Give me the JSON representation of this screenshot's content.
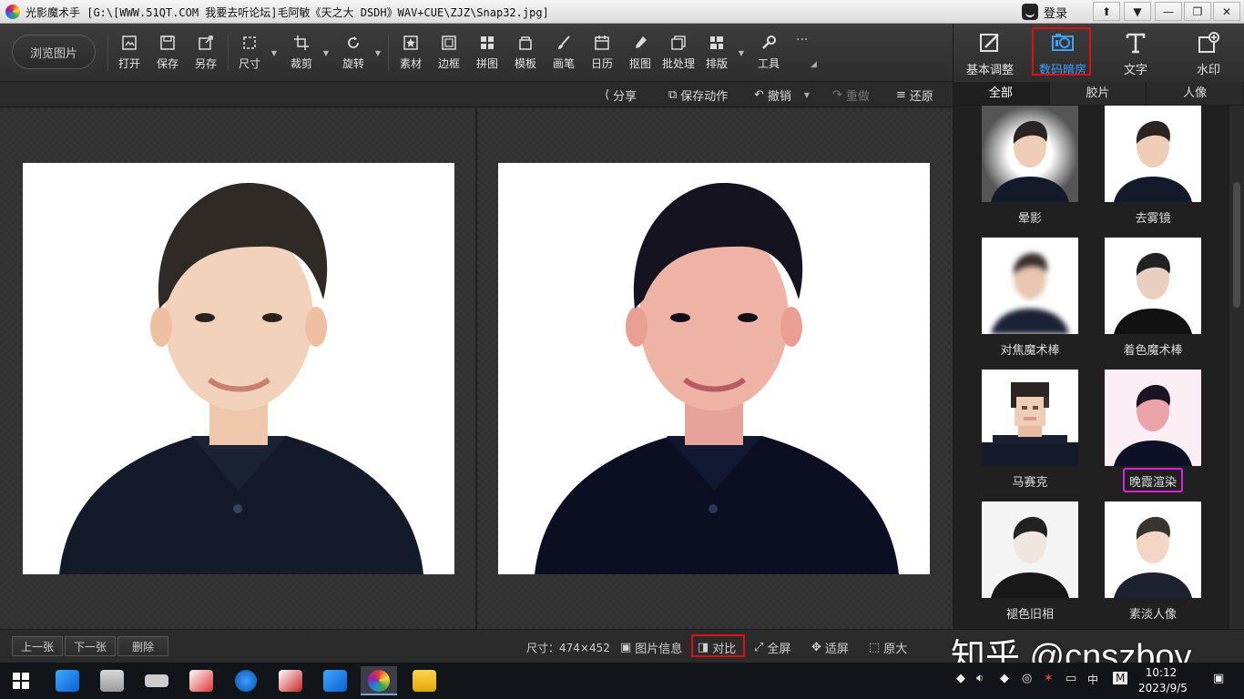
{
  "window": {
    "title": "光影魔术手 [G:\\[WWW.51QT.COM 我要去听论坛]毛阿敏《天之大 DSDH》WAV+CUE\\ZJZ\\Snap32.jpg]",
    "login_label": "登录",
    "controls": [
      "⬆",
      "▼",
      "—",
      "❐",
      "✕"
    ]
  },
  "toolbar": {
    "browse_label": "浏览图片",
    "tools": [
      {
        "label": "打开",
        "icon": "open-icon"
      },
      {
        "label": "保存",
        "icon": "save-icon"
      },
      {
        "label": "另存",
        "icon": "save-as-icon"
      },
      {
        "label": "尺寸",
        "icon": "resize-icon"
      },
      {
        "label": "裁剪",
        "icon": "crop-icon"
      },
      {
        "label": "旋转",
        "icon": "rotate-icon"
      },
      {
        "label": "素材",
        "icon": "material-icon"
      },
      {
        "label": "边框",
        "icon": "frame-icon"
      },
      {
        "label": "拼图",
        "icon": "collage-icon"
      },
      {
        "label": "模板",
        "icon": "template-icon"
      },
      {
        "label": "画笔",
        "icon": "brush-icon"
      },
      {
        "label": "日历",
        "icon": "calendar-icon"
      },
      {
        "label": "抠图",
        "icon": "cutout-icon"
      },
      {
        "label": "批处理",
        "icon": "batch-icon"
      },
      {
        "label": "排版",
        "icon": "layout-icon"
      },
      {
        "label": "工具",
        "icon": "wrench-icon"
      }
    ],
    "more_label": "···"
  },
  "modes": [
    {
      "label": "基本调整",
      "icon": "basic-adjust-icon"
    },
    {
      "label": "数码暗房",
      "icon": "darkroom-camera-icon",
      "active": true
    },
    {
      "label": "文字",
      "icon": "text-icon"
    },
    {
      "label": "水印",
      "icon": "watermark-icon"
    }
  ],
  "actions": {
    "share": "分享",
    "save_action": "保存动作",
    "undo": "撤销",
    "redo": "重做",
    "restore": "还原"
  },
  "effect_tabs": [
    "全部",
    "胶片",
    "人像"
  ],
  "effects": [
    {
      "label": "晕影"
    },
    {
      "label": "去雾镜"
    },
    {
      "label": "对焦魔术棒"
    },
    {
      "label": "着色魔术棒"
    },
    {
      "label": "马赛克"
    },
    {
      "label": "晚霞渲染",
      "highlighted": true
    },
    {
      "label": "褪色旧相"
    },
    {
      "label": "素淡人像"
    }
  ],
  "status": {
    "prev": "上一张",
    "next": "下一张",
    "delete": "删除",
    "size": "尺寸：474×452",
    "image_info": "图片信息",
    "compare": "对比",
    "fullscreen": "全屏",
    "fit": "适屏",
    "original": "原大"
  },
  "watermark": "知乎 @cnszboy",
  "taskbar": {
    "time": "10:12",
    "date": "2023/9/5",
    "ime": "中",
    "ime_mode": "M"
  },
  "colors": {
    "accent_blue": "#3fa0ff",
    "highlight_red": "#e01010",
    "highlight_magenta": "#e020e0"
  }
}
